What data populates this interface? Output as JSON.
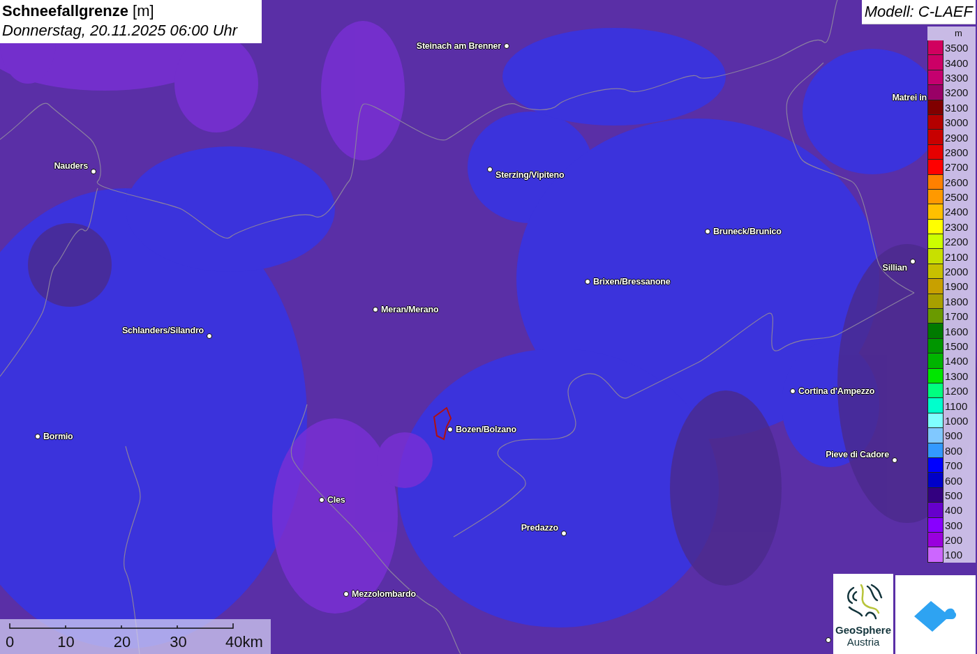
{
  "title": {
    "main": "Schneefallgrenze",
    "unit": "[m]",
    "subtitle": "Donnerstag, 20.11.2025 06:00 Uhr"
  },
  "model": "Modell: C-LAEF",
  "places": [
    {
      "name": "Steinach am Brenner"
    },
    {
      "name": "Nauders"
    },
    {
      "name": "Sterzing/Vipiteno"
    },
    {
      "name": "Matrei in"
    },
    {
      "name": "Bruneck/Brunico"
    },
    {
      "name": "Sillian"
    },
    {
      "name": "Brixen/Bressanone"
    },
    {
      "name": "Meran/Merano"
    },
    {
      "name": "Schlanders/Silandro"
    },
    {
      "name": "Cortina d'Ampezzo"
    },
    {
      "name": "Bormio"
    },
    {
      "name": "Bozen/Bolzano"
    },
    {
      "name": "Pieve di Cadore"
    },
    {
      "name": "Cles"
    },
    {
      "name": "Predazzo"
    },
    {
      "name": "Mezzolombardo"
    }
  ],
  "legend": {
    "unit": "m",
    "steps": [
      {
        "label": "3500",
        "color": "#d1005f"
      },
      {
        "label": "3400",
        "color": "#cc0066"
      },
      {
        "label": "3300",
        "color": "#c4006f"
      },
      {
        "label": "3200",
        "color": "#990066"
      },
      {
        "label": "3100",
        "color": "#800000"
      },
      {
        "label": "3000",
        "color": "#b30000"
      },
      {
        "label": "2900",
        "color": "#c80000"
      },
      {
        "label": "2800",
        "color": "#e60000"
      },
      {
        "label": "2700",
        "color": "#ff0000"
      },
      {
        "label": "2600",
        "color": "#ff8000"
      },
      {
        "label": "2500",
        "color": "#ff9900"
      },
      {
        "label": "2400",
        "color": "#ffc000"
      },
      {
        "label": "2300",
        "color": "#ffff00"
      },
      {
        "label": "2200",
        "color": "#ccff00"
      },
      {
        "label": "2100",
        "color": "#c8e000"
      },
      {
        "label": "2000",
        "color": "#c8c000"
      },
      {
        "label": "1900",
        "color": "#c8a000"
      },
      {
        "label": "1800",
        "color": "#a8a000"
      },
      {
        "label": "1700",
        "color": "#6a9a00"
      },
      {
        "label": "1600",
        "color": "#007a00"
      },
      {
        "label": "1500",
        "color": "#009600"
      },
      {
        "label": "1400",
        "color": "#00b400"
      },
      {
        "label": "1300",
        "color": "#00e600"
      },
      {
        "label": "1200",
        "color": "#00ff80"
      },
      {
        "label": "1100",
        "color": "#00ffcc"
      },
      {
        "label": "1000",
        "color": "#80ffff"
      },
      {
        "label": "900",
        "color": "#80c8ff"
      },
      {
        "label": "800",
        "color": "#3399ff"
      },
      {
        "label": "700",
        "color": "#0000ff"
      },
      {
        "label": "600",
        "color": "#0000c8"
      },
      {
        "label": "500",
        "color": "#330080"
      },
      {
        "label": "400",
        "color": "#6600cc"
      },
      {
        "label": "300",
        "color": "#8800ff"
      },
      {
        "label": "200",
        "color": "#9900dd"
      },
      {
        "label": "100",
        "color": "#cc66ff"
      }
    ]
  },
  "scale": [
    "0",
    "10",
    "20",
    "30",
    "40km"
  ],
  "logos": {
    "name": "GeoSphere",
    "sub": "Austria"
  }
}
